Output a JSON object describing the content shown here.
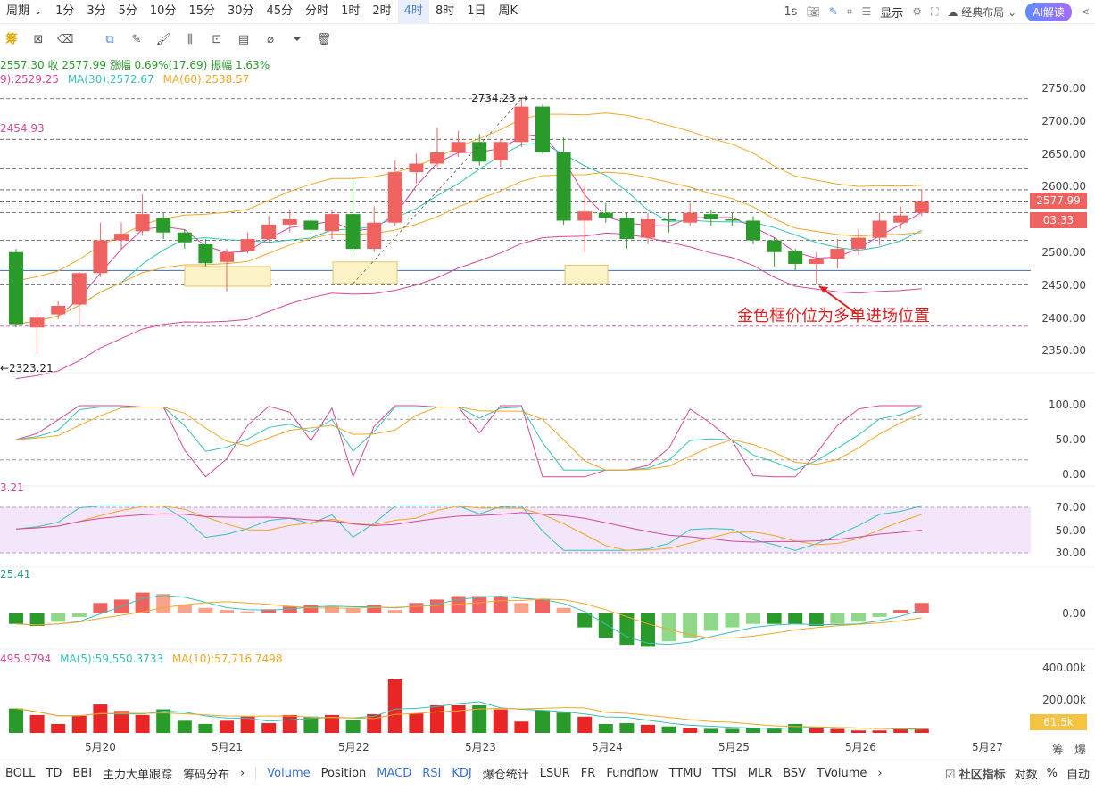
{
  "timeframes": {
    "period_label": "周期",
    "items": [
      "1分",
      "3分",
      "5分",
      "10分",
      "15分",
      "30分",
      "45分",
      "分时",
      "1时",
      "2时",
      "4时",
      "8时",
      "1日",
      "周K"
    ],
    "active": "4时"
  },
  "topright": {
    "interval": "1s",
    "display_label": "显示",
    "layout_label": "经典布局",
    "ai_label": "AI解读"
  },
  "toolbar": {
    "chip_label": "筹"
  },
  "info": {
    "line1": "2557.30  收 2577.99  涨幅 0.69%(17.69)  振幅 1.63%",
    "ma_a": "9):2529.25",
    "ma30": "MA(30):2572.67",
    "ma60": "MA(60):2538.57",
    "left_price": "2454.93",
    "high_label": "2734.23",
    "low_label": "2323.21",
    "kdj_value": "3.21",
    "macd_value": "25.41",
    "vol_line": "495.9794",
    "vol_ma5": "MA(5):59,550.3733",
    "vol_ma10": "MA(10):57,716.7498"
  },
  "annotation": {
    "text": "金色框价位为多单进场位置"
  },
  "price_axis": [
    "2750.00",
    "2700.00",
    "2650.00",
    "2600.00",
    "2550.00",
    "2500.00",
    "2450.00",
    "2400.00",
    "2350.00"
  ],
  "price_tags": {
    "current": "2577.99",
    "countdown": "03:33"
  },
  "kdj_axis": [
    "100.00",
    "50.00",
    "0.00"
  ],
  "rsi_axis": [
    "70.00",
    "50.00",
    "30.00"
  ],
  "macd_axis": [
    "0.00"
  ],
  "vol_axis": [
    "400.00k",
    "200.00k"
  ],
  "vol_tag": "61.5k",
  "dates": [
    "5月20",
    "5月21",
    "5月22",
    "5月23",
    "5月24",
    "5月25",
    "5月26",
    "5月27"
  ],
  "bottom_right_icons": [
    "筹",
    "爆"
  ],
  "bottom_indicators": [
    {
      "label": "BOLL",
      "blue": false
    },
    {
      "label": "TD",
      "blue": false
    },
    {
      "label": "BBI",
      "blue": false
    },
    {
      "label": "主力大单跟踪",
      "blue": false
    },
    {
      "label": "筹码分布",
      "blue": false
    },
    {
      "label": "Volume",
      "blue": true
    },
    {
      "label": "Position",
      "blue": false
    },
    {
      "label": "MACD",
      "blue": true
    },
    {
      "label": "RSI",
      "blue": true
    },
    {
      "label": "KDJ",
      "blue": true
    },
    {
      "label": "爆仓统计",
      "blue": false
    },
    {
      "label": "LSUR",
      "blue": false
    },
    {
      "label": "FR",
      "blue": false
    },
    {
      "label": "Fundflow",
      "blue": false
    },
    {
      "label": "TTMU",
      "blue": false
    },
    {
      "label": "TTSI",
      "blue": false
    },
    {
      "label": "MLR",
      "blue": false
    },
    {
      "label": "BSV",
      "blue": false
    },
    {
      "label": "TVolume",
      "blue": false
    }
  ],
  "bottom_right": {
    "community": "社区指标",
    "log": "对数",
    "pct": "%",
    "auto": "自动"
  },
  "colors": {
    "up": "#f0625f",
    "down": "#2a9a2a",
    "ma_orange": "#f5a623",
    "ma_pink": "#d6479b",
    "ma_teal": "#35c2b8",
    "gold_box": "#fbf3c6"
  },
  "chart_data": {
    "type": "candlestick",
    "candles": [
      {
        "o": 2500,
        "c": 2390,
        "h": 2505,
        "l": 2385
      },
      {
        "o": 2385,
        "c": 2400,
        "h": 2410,
        "l": 2345
      },
      {
        "o": 2405,
        "c": 2418,
        "h": 2425,
        "l": 2398
      },
      {
        "o": 2420,
        "c": 2468,
        "h": 2470,
        "l": 2390
      },
      {
        "o": 2468,
        "c": 2518,
        "h": 2545,
        "l": 2462
      },
      {
        "o": 2518,
        "c": 2528,
        "h": 2545,
        "l": 2505
      },
      {
        "o": 2532,
        "c": 2558,
        "h": 2588,
        "l": 2525
      },
      {
        "o": 2552,
        "c": 2530,
        "h": 2560,
        "l": 2520
      },
      {
        "o": 2530,
        "c": 2515,
        "h": 2535,
        "l": 2505
      },
      {
        "o": 2512,
        "c": 2483,
        "h": 2520,
        "l": 2478
      },
      {
        "o": 2485,
        "c": 2500,
        "h": 2505,
        "l": 2440
      },
      {
        "o": 2502,
        "c": 2520,
        "h": 2530,
        "l": 2498
      },
      {
        "o": 2520,
        "c": 2542,
        "h": 2555,
        "l": 2515
      },
      {
        "o": 2542,
        "c": 2550,
        "h": 2565,
        "l": 2530
      },
      {
        "o": 2548,
        "c": 2534,
        "h": 2552,
        "l": 2528
      },
      {
        "o": 2532,
        "c": 2558,
        "h": 2565,
        "l": 2520
      },
      {
        "o": 2558,
        "c": 2505,
        "h": 2610,
        "l": 2495
      },
      {
        "o": 2505,
        "c": 2545,
        "h": 2570,
        "l": 2500
      },
      {
        "o": 2545,
        "c": 2622,
        "h": 2640,
        "l": 2540
      },
      {
        "o": 2622,
        "c": 2635,
        "h": 2650,
        "l": 2605
      },
      {
        "o": 2635,
        "c": 2652,
        "h": 2690,
        "l": 2630
      },
      {
        "o": 2652,
        "c": 2668,
        "h": 2685,
        "l": 2645
      },
      {
        "o": 2668,
        "c": 2638,
        "h": 2680,
        "l": 2632
      },
      {
        "o": 2640,
        "c": 2668,
        "h": 2672,
        "l": 2630
      },
      {
        "o": 2668,
        "c": 2722,
        "h": 2734,
        "l": 2660
      },
      {
        "o": 2722,
        "c": 2652,
        "h": 2725,
        "l": 2650
      },
      {
        "o": 2652,
        "c": 2548,
        "h": 2675,
        "l": 2542
      },
      {
        "o": 2548,
        "c": 2562,
        "h": 2600,
        "l": 2500
      },
      {
        "o": 2560,
        "c": 2552,
        "h": 2575,
        "l": 2545
      },
      {
        "o": 2552,
        "c": 2520,
        "h": 2560,
        "l": 2505
      },
      {
        "o": 2522,
        "c": 2550,
        "h": 2560,
        "l": 2512
      },
      {
        "o": 2550,
        "c": 2548,
        "h": 2560,
        "l": 2530
      },
      {
        "o": 2545,
        "c": 2560,
        "h": 2575,
        "l": 2540
      },
      {
        "o": 2558,
        "c": 2550,
        "h": 2565,
        "l": 2540
      },
      {
        "o": 2550,
        "c": 2548,
        "h": 2560,
        "l": 2540
      },
      {
        "o": 2548,
        "c": 2518,
        "h": 2555,
        "l": 2512
      },
      {
        "o": 2518,
        "c": 2500,
        "h": 2522,
        "l": 2478
      },
      {
        "o": 2502,
        "c": 2482,
        "h": 2505,
        "l": 2472
      },
      {
        "o": 2482,
        "c": 2490,
        "h": 2500,
        "l": 2452
      },
      {
        "o": 2490,
        "c": 2505,
        "h": 2520,
        "l": 2475
      },
      {
        "o": 2505,
        "c": 2522,
        "h": 2535,
        "l": 2495
      },
      {
        "o": 2522,
        "c": 2548,
        "h": 2560,
        "l": 2510
      },
      {
        "o": 2545,
        "c": 2556,
        "h": 2570,
        "l": 2535
      },
      {
        "o": 2560,
        "c": 2578,
        "h": 2596,
        "l": 2555
      }
    ],
    "volume": [
      150,
      110,
      55,
      105,
      175,
      135,
      110,
      145,
      75,
      55,
      75,
      100,
      60,
      110,
      100,
      110,
      80,
      115,
      330,
      120,
      170,
      170,
      170,
      145,
      70,
      140,
      125,
      100,
      55,
      60,
      50,
      40,
      30,
      25,
      25,
      30,
      25,
      55,
      30,
      25,
      15,
      15,
      30,
      25
    ],
    "macd": [
      -15,
      -18,
      -12,
      -5,
      15,
      20,
      30,
      28,
      12,
      8,
      5,
      3,
      6,
      10,
      12,
      10,
      7,
      12,
      5,
      15,
      20,
      25,
      25,
      25,
      15,
      20,
      8,
      -20,
      -35,
      -45,
      -48,
      -40,
      -35,
      -25,
      -20,
      -15,
      -15,
      -15,
      -18,
      -15,
      -12,
      -5,
      5,
      15
    ],
    "price_ylim": [
      2323.21,
      2734.23
    ]
  }
}
